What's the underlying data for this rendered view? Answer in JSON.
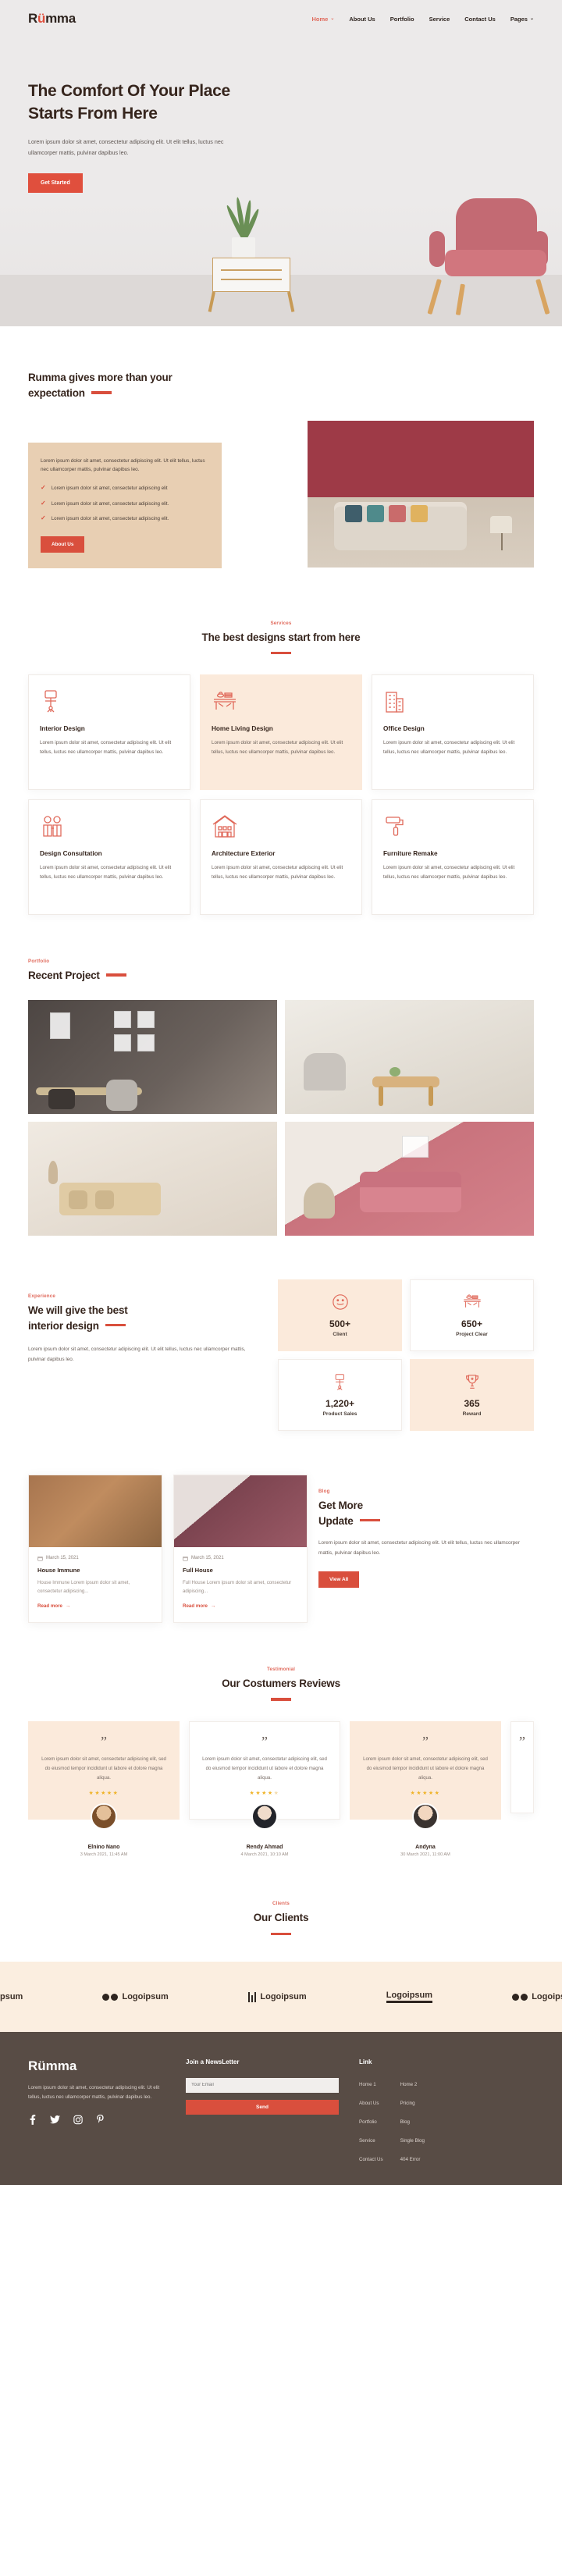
{
  "brand": {
    "name_pre": "R",
    "name_u": "ü",
    "name_post": "mma",
    "full": "Rümma"
  },
  "nav": {
    "items": [
      {
        "label": "Home",
        "active": true,
        "caret": "⌄"
      },
      {
        "label": "About Us",
        "active": false,
        "caret": ""
      },
      {
        "label": "Portfolio",
        "active": false,
        "caret": ""
      },
      {
        "label": "Service",
        "active": false,
        "caret": ""
      },
      {
        "label": "Contact Us",
        "active": false,
        "caret": ""
      },
      {
        "label": "Pages",
        "active": false,
        "caret": "⌄"
      }
    ]
  },
  "hero": {
    "title_line1": "The Comfort Of Your Place",
    "title_line2": "Starts From Here",
    "paragraph": "Lorem ipsum dolor sit amet, consectetur adipiscing elit. Ut elit tellus, luctus nec ullamcorper mattis, pulvinar dapibus leo.",
    "cta": "Get Started"
  },
  "about": {
    "title_line1": "Rumma gives more than your",
    "title_line2": "expectation",
    "lead": "Lorem ipsum dolor sit amet, consectetur adipiscing elit. Ut elit tellus, luctus nec ullamcorper mattis, pulvinar dapibus leo.",
    "checks": [
      "Lorem ipsum dolor sit amet, consectetur adipiscing elit",
      "Lorem ipsum dolor sit amet, consectetur adipiscing elit.",
      "Lorem ipsum dolor sit amet, consectetur adipiscing elit."
    ],
    "cta": "About Us"
  },
  "services": {
    "eyebrow": "Services",
    "title": "The best designs start from here",
    "cards": [
      {
        "icon": "office-chair-icon",
        "title": "Interior Design",
        "text": "Lorem ipsum dolor sit amet, consectetur adipiscing elit. Ut elit tellus, luctus nec ullamcorper mattis, pulvinar dapibus leo.",
        "highlight": false
      },
      {
        "icon": "living-table-icon",
        "title": "Home Living Design",
        "text": "Lorem ipsum dolor sit amet, consectetur adipiscing elit. Ut elit tellus, luctus nec ullamcorper mattis, pulvinar dapibus leo.",
        "highlight": true
      },
      {
        "icon": "office-building-icon",
        "title": "Office Design",
        "text": "Lorem ipsum dolor sit amet, consectetur adipiscing elit. Ut elit tellus, luctus nec ullamcorper mattis, pulvinar dapibus leo.",
        "highlight": false
      },
      {
        "icon": "consultation-people-icon",
        "title": "Design Consultation",
        "text": "Lorem ipsum dolor sit amet, consectetur adipiscing elit. Ut elit tellus, luctus nec ullamcorper mattis, pulvinar dapibus leo.",
        "highlight": false
      },
      {
        "icon": "house-architecture-icon",
        "title": "Architecture Exterior",
        "text": "Lorem ipsum dolor sit amet, consectetur adipiscing elit. Ut elit tellus, luctus nec ullamcorper mattis, pulvinar dapibus leo.",
        "highlight": false
      },
      {
        "icon": "paint-roller-icon",
        "title": "Furniture Remake",
        "text": "Lorem ipsum dolor sit amet, consectetur adipiscing elit. Ut elit tellus, luctus nec ullamcorper mattis, pulvinar dapibus leo.",
        "highlight": false
      }
    ]
  },
  "portfolio": {
    "eyebrow": "Portfolio",
    "title": "Recent Project"
  },
  "experience": {
    "eyebrow": "Experience",
    "title_line1": "We will give the best",
    "title_line2": "interior design",
    "paragraph": "Lorem ipsum dolor sit amet, consectetur adipiscing elit. Ut elit tellus, luctus nec ullamcorper mattis, pulvinar dapibus leo.",
    "stats": [
      {
        "icon": "smiley-icon",
        "value": "500+",
        "label": "Client",
        "highlight": true
      },
      {
        "icon": "living-table-icon",
        "value": "650+",
        "label": "Project Clear",
        "highlight": false
      },
      {
        "icon": "office-chair-icon",
        "value": "1,220+",
        "label": "Product Sales",
        "highlight": false
      },
      {
        "icon": "trophy-icon",
        "value": "365",
        "label": "Reward",
        "highlight": true
      }
    ]
  },
  "blog": {
    "eyebrow": "Blog",
    "title_line1": "Get More",
    "title_line2": "Update",
    "paragraph": "Lorem ipsum dolor sit amet, consectetur adipiscing elit. Ut elit tellus, luctus nec ullamcorper mattis, pulvinar dapibus leo.",
    "cta": "View All",
    "posts": [
      {
        "date": "March 15, 2021",
        "title": "House Immune",
        "text": "House Immune Lorem ipsum dolor sit amet, consectetur adipiscing...",
        "more": "Read more"
      },
      {
        "date": "March 15, 2021",
        "title": "Full House",
        "text": "Full House Lorem ipsum dolor sit amet, consectetur adipiscing...",
        "more": "Read more"
      }
    ]
  },
  "testimonial": {
    "eyebrow": "Testimonial",
    "title": "Our Costumers Reviews",
    "items": [
      {
        "quote_glyph": "\"",
        "text": "Lorem ipsum dolor sit amet, consectetur adipiscing elit, sed do eiusmod tempor incididunt ut labore et dolore magna aliqua.",
        "stars_filled": 5,
        "stars_total": 5,
        "name": "Elnino Nano",
        "date": "3 March 2021, 11:45 AM",
        "highlight": true
      },
      {
        "quote_glyph": "\"",
        "text": "Lorem ipsum dolor sit amet, consectetur adipiscing elit, sed do eiusmod tempor incididunt ut labore et dolore magna aliqua.",
        "stars_filled": 4,
        "stars_total": 5,
        "name": "Rendy Ahmad",
        "date": "4 March 2021, 10:10 AM",
        "highlight": false
      },
      {
        "quote_glyph": "\"",
        "text": "Lorem ipsum dolor sit amet, consectetur adipiscing elit, sed do eiusmod tempor incididunt ut labore et dolore magna aliqua.",
        "stars_filled": 5,
        "stars_total": 5,
        "name": "Andyna",
        "date": "30 March 2021, 11:00 AM",
        "highlight": true
      }
    ]
  },
  "clients": {
    "eyebrow": "Clients",
    "title": "Our Clients",
    "logos": [
      {
        "text": "psum",
        "style": "plain-cut"
      },
      {
        "text": "Logoipsum",
        "style": "dots"
      },
      {
        "text": "Logoipsum",
        "style": "bars"
      },
      {
        "text": "Logoipsum",
        "style": "underline"
      },
      {
        "text": "Logoips",
        "style": "dots-cut"
      }
    ]
  },
  "footer": {
    "logo": "Rümma",
    "description": "Lorem ipsum dolor sit amet, consectetur adipiscing elit. Ut elit tellus, luctus nec ullamcorper mattis, pulvinar dapibus leo.",
    "social": [
      "facebook-icon",
      "twitter-icon",
      "instagram-icon",
      "pinterest-icon"
    ],
    "newsletter": {
      "heading": "Join a NewsLetter",
      "placeholder": "Your Email",
      "value": "",
      "button": "Send"
    },
    "links_heading": "Link",
    "links_col1": [
      "Home 1",
      "About Us",
      "Portfolio",
      "Service",
      "Contact Us"
    ],
    "links_col2": [
      "Home 2",
      "Pricing",
      "Blog",
      "Single Blog",
      "404 Error"
    ]
  },
  "colors": {
    "accent": "#d94f3d",
    "accent_soft": "#e06a5c",
    "cream": "#fbeadb",
    "tan": "#e8cfb3",
    "dark": "#36251d",
    "footer_bg": "#584c45",
    "star": "#f0b429"
  }
}
